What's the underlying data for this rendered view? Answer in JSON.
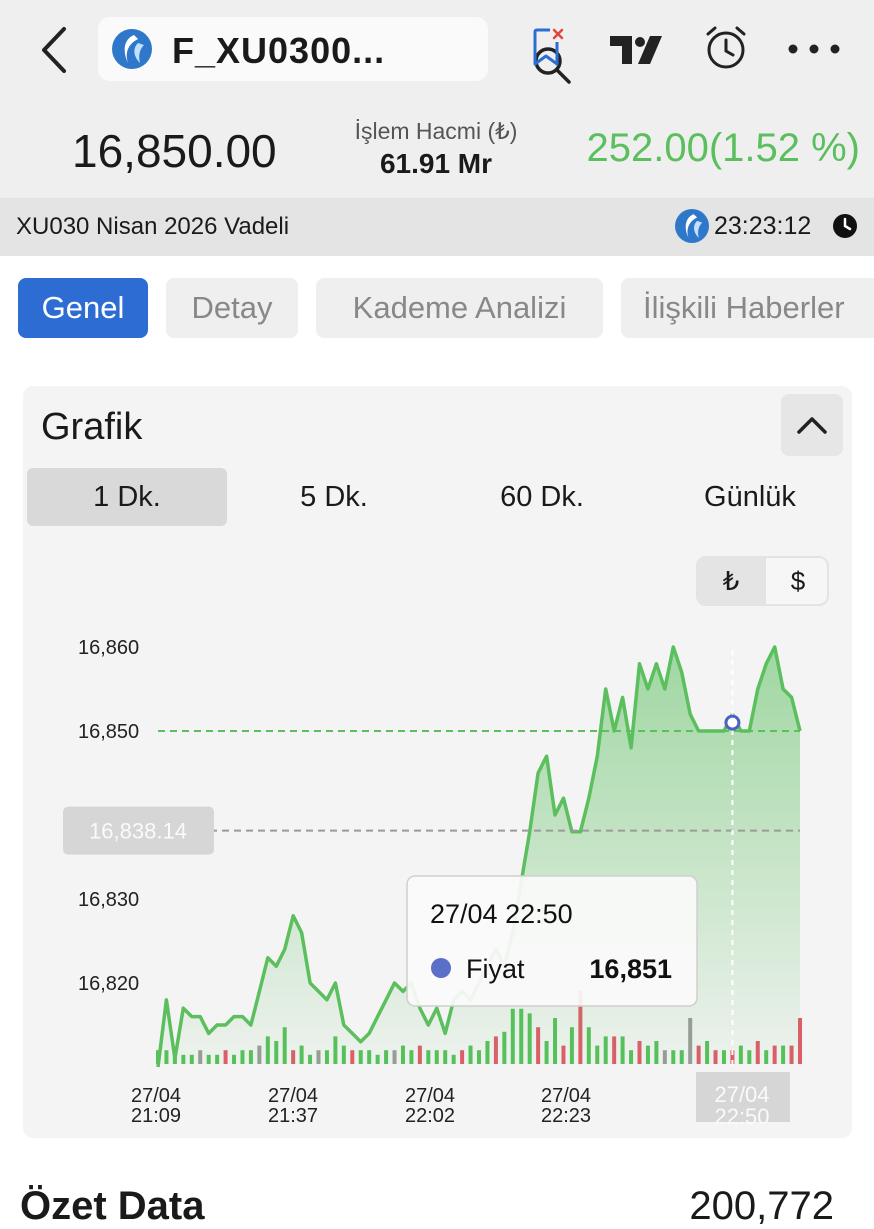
{
  "header": {
    "symbol": "F_XU0300...",
    "price": "16,850.00",
    "volume_label": "İşlem Hacmi (₺)",
    "volume_value": "61.91 Mr",
    "change": "252.00",
    "change_pct": "(1.52 %)",
    "accent_color": "#5bbf5e",
    "icons": [
      "back-icon",
      "search-icon",
      "bookmark-remove-icon",
      "tradingview-icon",
      "alarm-icon",
      "more-icon"
    ]
  },
  "info": {
    "contract": "XU030 Nisan 2026 Vadeli",
    "time": "23:23:12"
  },
  "tabs": [
    {
      "label": "Genel",
      "active": true
    },
    {
      "label": "Detay",
      "active": false
    },
    {
      "label": "Kademe Analizi",
      "active": false
    },
    {
      "label": "İlişkili Haberler",
      "active": false
    }
  ],
  "card": {
    "title": "Grafik",
    "periods": [
      "1 Dk.",
      "5 Dk.",
      "60 Dk.",
      "Günlük"
    ],
    "selected_period": "1 Dk.",
    "currencies": [
      "₺",
      "$"
    ],
    "selected_currency": "₺"
  },
  "chart_data": {
    "type": "area",
    "y_ticks": [
      16860,
      16850,
      16830,
      16820
    ],
    "y_tick_labels": [
      "16,860",
      "16,850",
      "16,830",
      "16,820"
    ],
    "ylim": [
      16810,
      16862
    ],
    "reference_lines": [
      {
        "label": "16,850",
        "value": 16850,
        "color": "#5bbf5e"
      },
      {
        "label": "16,838.14",
        "value": 16838.14,
        "color": "#999999"
      }
    ],
    "x_ticks": [
      {
        "date": "27/04",
        "time": "21:09"
      },
      {
        "date": "27/04",
        "time": "21:37"
      },
      {
        "date": "27/04",
        "time": "22:02"
      },
      {
        "date": "27/04",
        "time": "22:23"
      },
      {
        "date": "27/04",
        "time": "22:50"
      }
    ],
    "price_series": [
      16810,
      16818,
      16811,
      16817,
      16816,
      16816,
      16814,
      16815,
      16815,
      16816,
      16816,
      16815,
      16819,
      16823,
      16822,
      16824,
      16828,
      16826,
      16820,
      16819,
      16818,
      16820,
      16815,
      16814,
      16813,
      16814,
      16816,
      16818,
      16820,
      16819,
      16820,
      16817,
      16815,
      16817,
      16814,
      16818,
      16819,
      16818,
      16820,
      16822,
      16824,
      16822,
      16826,
      16832,
      16838,
      16845,
      16847,
      16840,
      16842,
      16838,
      16838,
      16842,
      16847,
      16855,
      16850,
      16854,
      16848,
      16858,
      16855,
      16858,
      16855,
      16860,
      16857,
      16852,
      16850,
      16850,
      16850,
      16850,
      16852,
      16850,
      16850,
      16855,
      16858,
      16860,
      16855,
      16854,
      16850
    ],
    "volume_series": [
      3,
      3,
      2,
      2,
      2,
      3,
      2,
      2,
      3,
      2,
      3,
      3,
      4,
      6,
      5,
      8,
      3,
      4,
      2,
      3,
      3,
      6,
      4,
      3,
      3,
      3,
      2,
      3,
      3,
      4,
      3,
      4,
      3,
      3,
      3,
      2,
      3,
      4,
      3,
      5,
      6,
      7,
      12,
      12,
      11,
      8,
      5,
      10,
      4,
      8,
      16,
      8,
      4,
      6,
      6,
      6,
      3,
      5,
      4,
      5,
      3,
      3,
      3,
      10,
      4,
      5,
      3,
      3,
      3,
      4,
      3,
      5,
      3,
      4,
      4,
      4,
      10
    ],
    "volume_colors": [
      "g",
      "g",
      "g",
      "g",
      "g",
      "gr",
      "g",
      "g",
      "r",
      "g",
      "g",
      "g",
      "gr",
      "g",
      "g",
      "g",
      "r",
      "g",
      "g",
      "gr",
      "g",
      "g",
      "g",
      "r",
      "g",
      "g",
      "g",
      "g",
      "gr",
      "g",
      "g",
      "r",
      "g",
      "g",
      "g",
      "g",
      "r",
      "g",
      "g",
      "g",
      "r",
      "g",
      "g",
      "g",
      "g",
      "r",
      "g",
      "g",
      "r",
      "g",
      "r",
      "g",
      "g",
      "g",
      "r",
      "g",
      "g",
      "r",
      "g",
      "g",
      "gr",
      "g",
      "g",
      "gr",
      "r",
      "g",
      "r",
      "g",
      "r",
      "g",
      "g",
      "r",
      "g",
      "r",
      "g",
      "r",
      "r"
    ],
    "tooltip": {
      "datetime": "27/04 22:50",
      "series_name": "Fiyat",
      "value": "16,851",
      "marker_color": "#5a6fc7"
    }
  },
  "footer": {
    "label": "Özet Data",
    "value": "200,772"
  }
}
